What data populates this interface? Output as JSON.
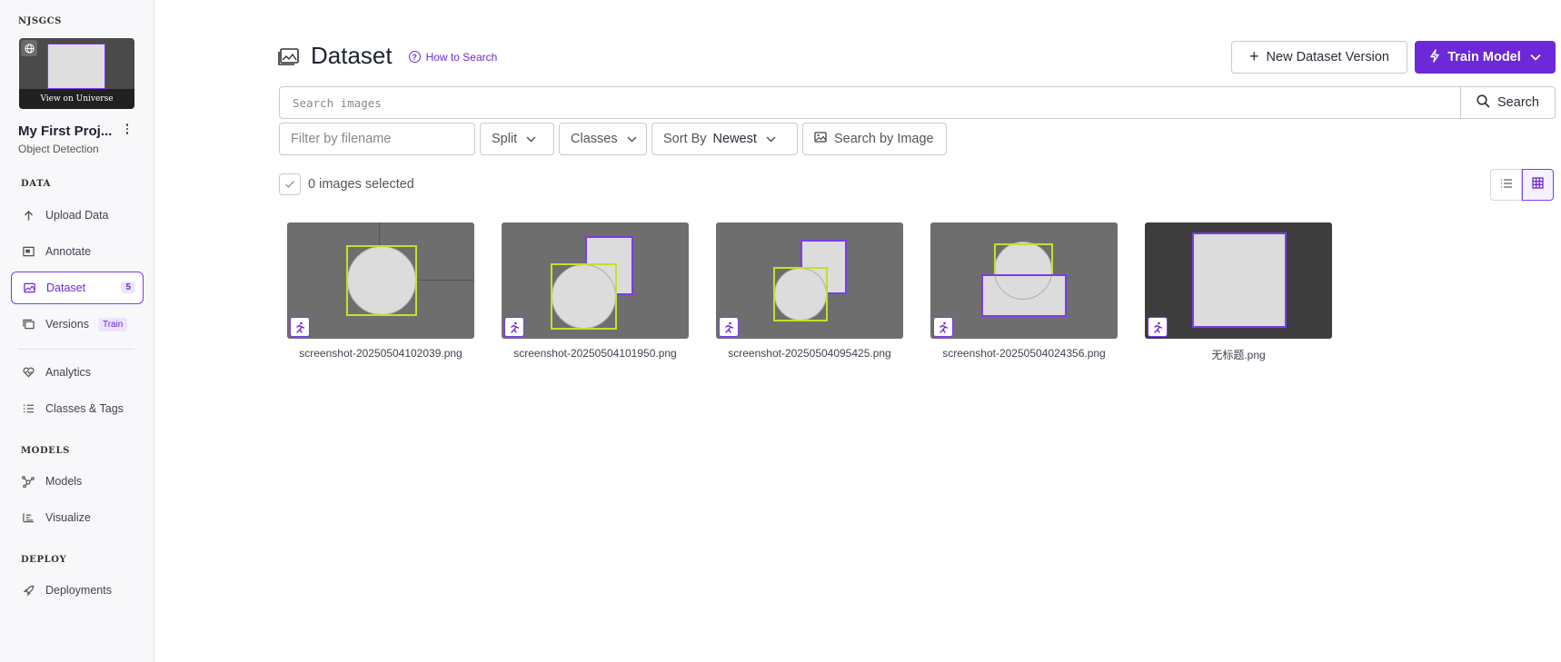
{
  "workspace": "NJSGCS",
  "thumbnail": {
    "view_label": "View on Universe"
  },
  "project": {
    "name": "My First Proj...",
    "type": "Object Detection"
  },
  "sidebar": {
    "sections": {
      "data": "DATA",
      "models": "MODELS",
      "deploy": "DEPLOY"
    },
    "items": [
      {
        "label": "Upload Data",
        "icon": "upload-icon"
      },
      {
        "label": "Annotate",
        "icon": "annotate-icon"
      },
      {
        "label": "Dataset",
        "icon": "dataset-icon",
        "badge": "5",
        "active": true
      },
      {
        "label": "Versions",
        "icon": "versions-icon",
        "pill": "Train"
      },
      {
        "label": "Analytics",
        "icon": "analytics-icon"
      },
      {
        "label": "Classes & Tags",
        "icon": "classes-icon"
      },
      {
        "label": "Models",
        "icon": "models-icon"
      },
      {
        "label": "Visualize",
        "icon": "visualize-icon"
      },
      {
        "label": "Deployments",
        "icon": "rocket-icon"
      }
    ]
  },
  "header": {
    "title": "Dataset",
    "how_to": "How to Search",
    "new_version": "New Dataset Version",
    "train": "Train Model"
  },
  "search": {
    "placeholder": "Search images",
    "button": "Search"
  },
  "filters": {
    "filename_placeholder": "Filter by filename",
    "split": "Split",
    "classes": "Classes",
    "sort_label": "Sort By",
    "sort_value": "Newest",
    "search_by_image": "Search by Image"
  },
  "selection": {
    "text": "0 images selected"
  },
  "colors": {
    "accent": "#6d28d9",
    "bbox_yellow": "#c4e02a",
    "bbox_purple": "#7c3aed"
  },
  "images": [
    {
      "filename": "screenshot-20250504102039.png"
    },
    {
      "filename": "screenshot-20250504101950.png"
    },
    {
      "filename": "screenshot-20250504095425.png"
    },
    {
      "filename": "screenshot-20250504024356.png"
    },
    {
      "filename": "无标题.png"
    }
  ]
}
